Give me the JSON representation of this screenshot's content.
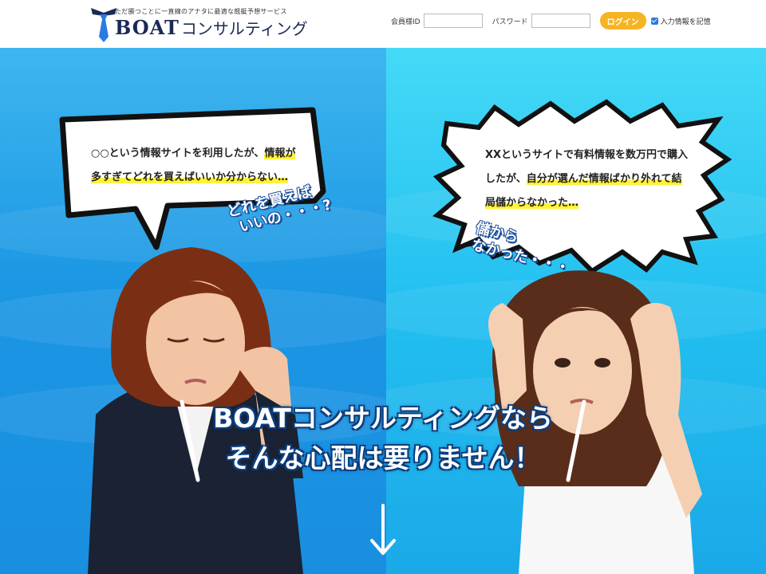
{
  "header": {
    "tagline": "ただ勝つことに一直線のアナタに最適な競艇予想サービス",
    "brand_en": "BOAT",
    "brand_ja": "コンサルティング",
    "login": {
      "member_id_label": "会員様ID",
      "member_id_value": "",
      "password_label": "パスワード",
      "password_value": "",
      "login_button": "ログイン",
      "remember_label": "入力情報を記憶",
      "remember_checked": true
    }
  },
  "hero": {
    "left_bubble": {
      "line1_plain": "○○という情報サイトを利用したが、",
      "line1_hl": "情報が",
      "line2_hl": "多すぎてどれを買えばいいか分からない…"
    },
    "left_aside": [
      "どれを買えば",
      "いいの・・・?"
    ],
    "right_bubble": {
      "line1_plain": "XXというサイトで有料情報を数万円で購入",
      "line2_plain": "したが、",
      "line2_hl": "自分が選んだ情報ばかり外れて結",
      "line3_hl": "局儲からなかった…"
    },
    "right_aside": [
      "儲から",
      "なかった・・・"
    ],
    "headline": [
      "BOATコンサルティングなら",
      "そんな心配は要りません！"
    ]
  },
  "colors": {
    "brand_navy": "#1b2a55",
    "login_button": "#f6b424",
    "left_panel": "#1b97e4",
    "right_panel": "#22bff0",
    "highlight": "#fff23a"
  },
  "icons": [
    "necktie-logo-icon",
    "checkbox-checked-icon",
    "down-arrow-icon"
  ]
}
